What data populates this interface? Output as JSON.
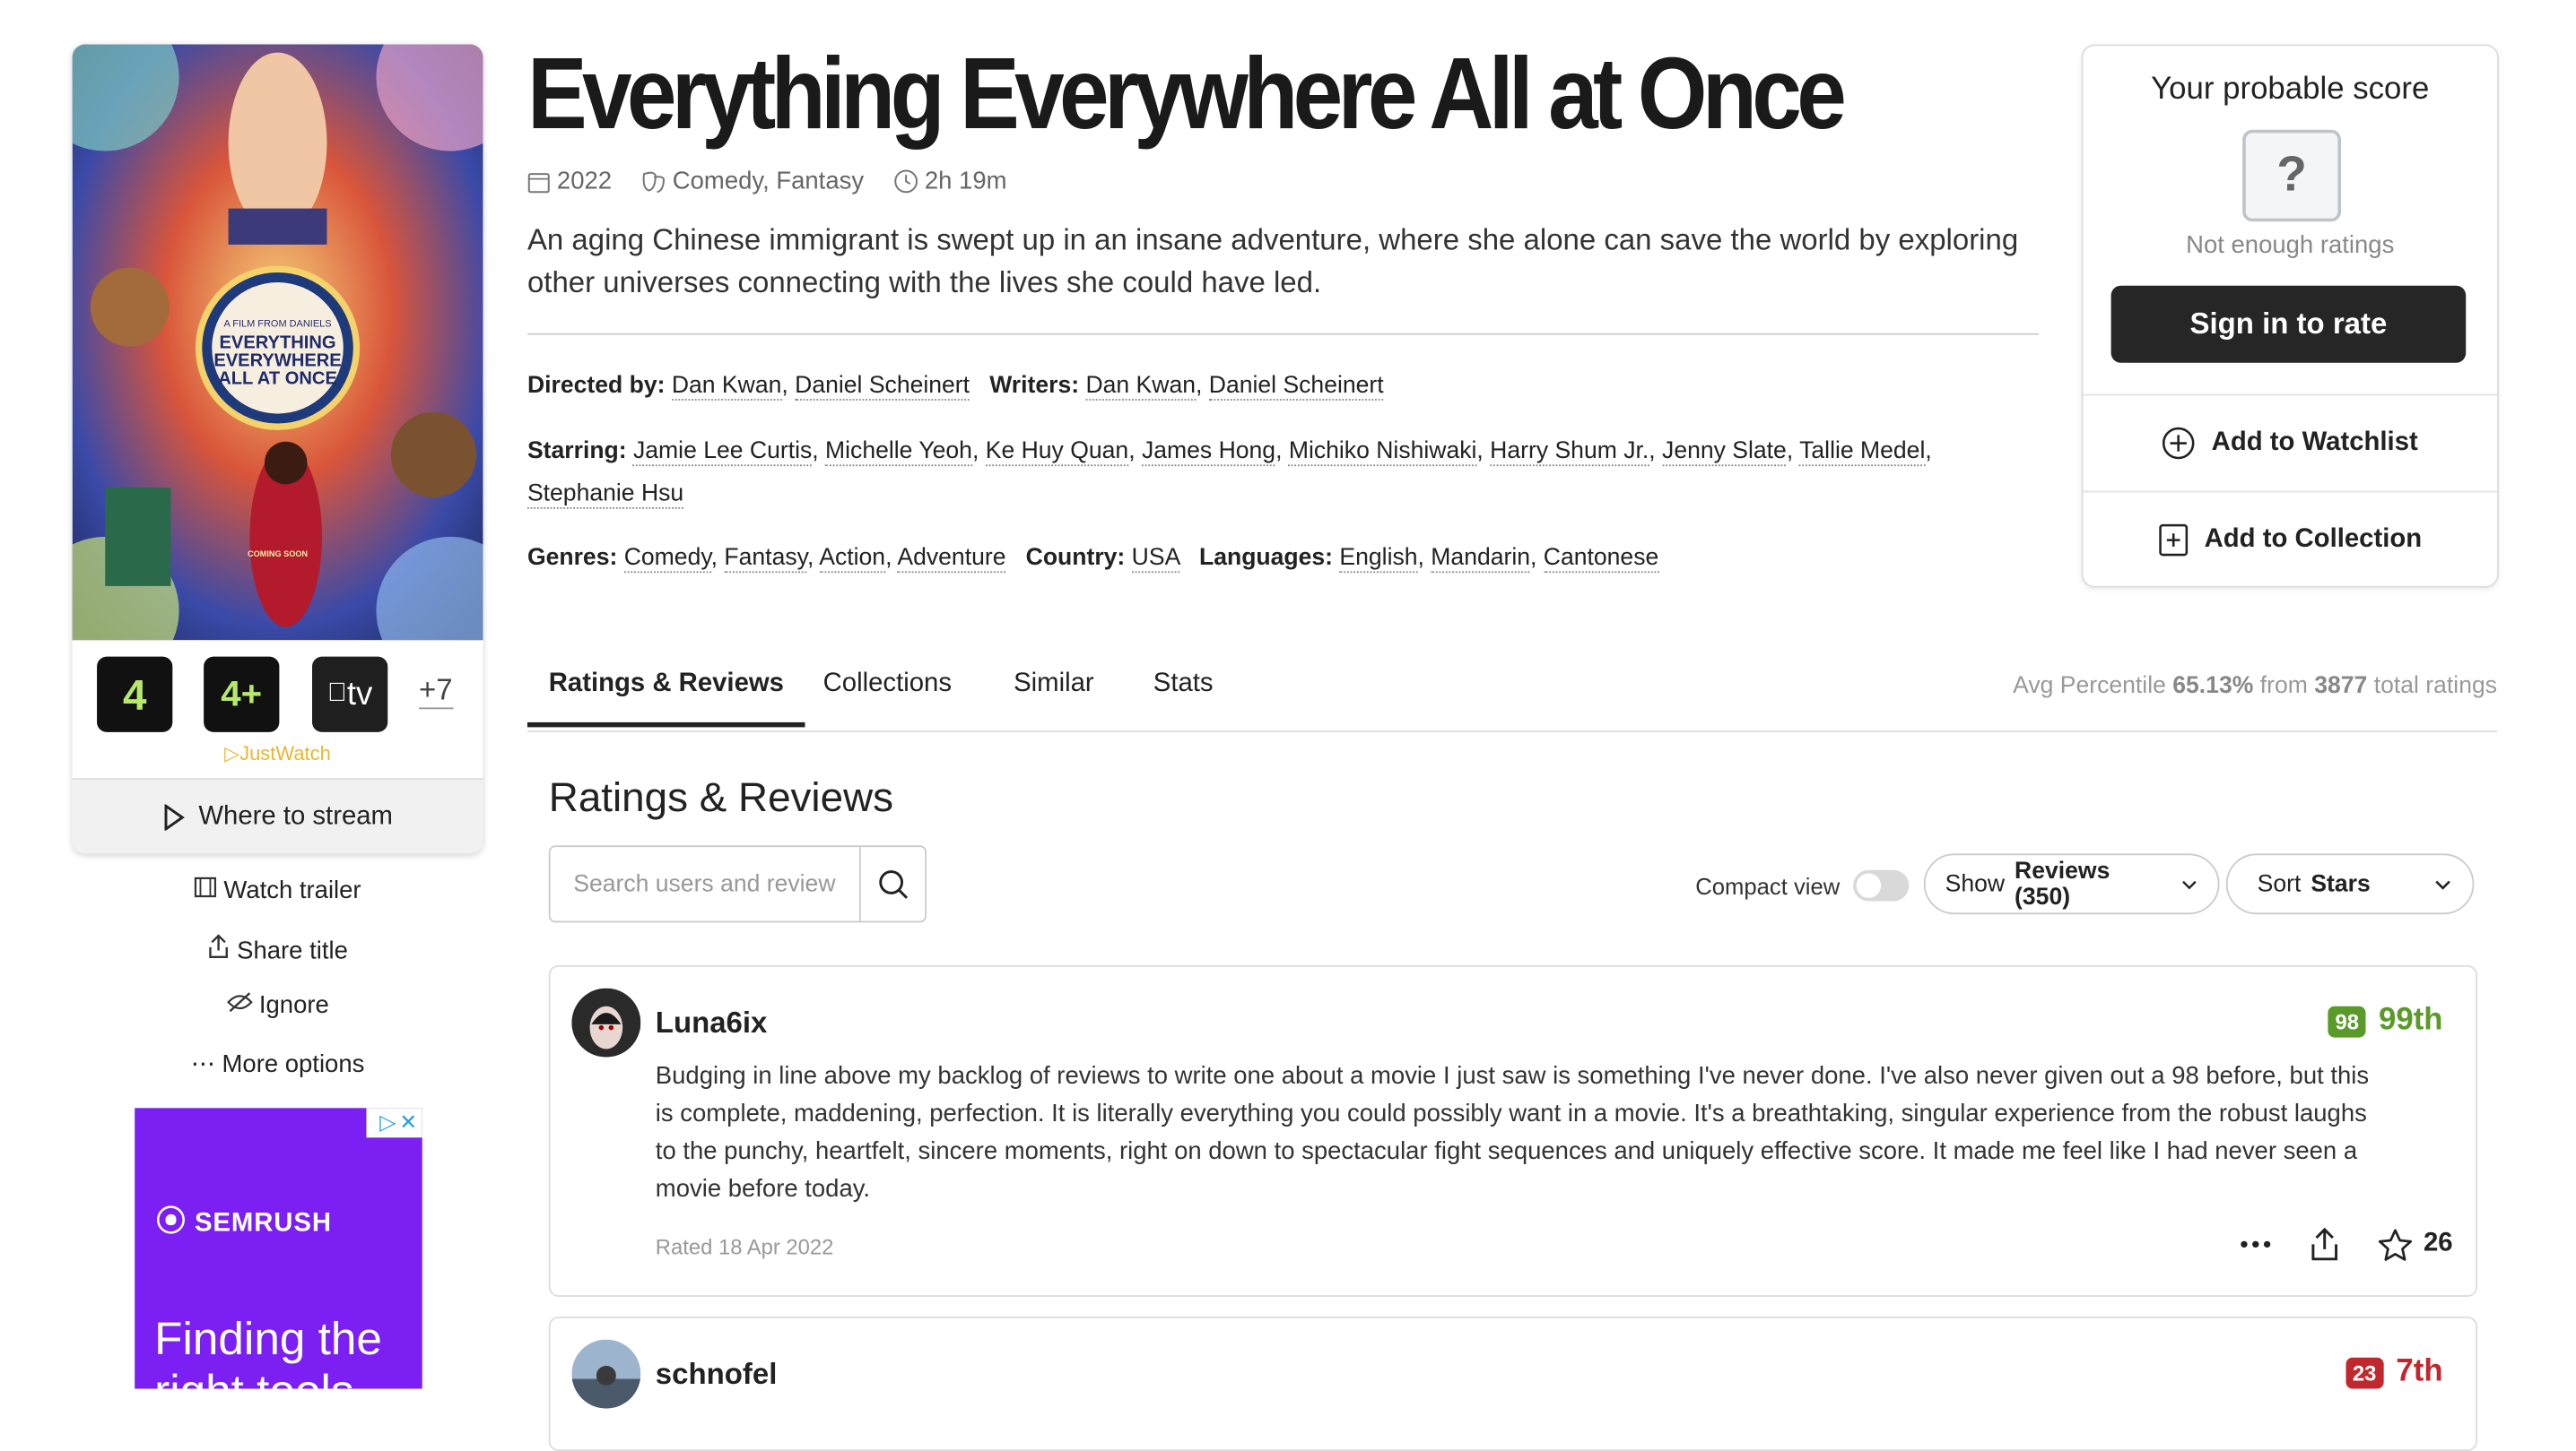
{
  "movie": {
    "title": "Everything Everywhere All at Once",
    "year": "2022",
    "genres_short": "Comedy, Fantasy",
    "runtime": "2h 19m",
    "description": "An aging Chinese immigrant is swept up in an insane adventure, where she alone can save the world by exploring other universes connecting with the lives she could have led.",
    "directed_label": "Directed by:",
    "directors": [
      "Dan Kwan",
      "Daniel Scheinert"
    ],
    "writers_label": "Writers:",
    "writers": [
      "Dan Kwan",
      "Daniel Scheinert"
    ],
    "starring_label": "Starring:",
    "cast": [
      "Jamie Lee Curtis",
      "Michelle Yeoh",
      "Ke Huy Quan",
      "James Hong",
      "Michiko Nishiwaki",
      "Harry Shum Jr.",
      "Jenny Slate",
      "Tallie Medel",
      "Stephanie Hsu"
    ],
    "genres_label": "Genres:",
    "genres": [
      "Comedy",
      "Fantasy",
      "Action",
      "Adventure"
    ],
    "country_label": "Country:",
    "country": "USA",
    "languages_label": "Languages:",
    "languages": [
      "English",
      "Mandarin",
      "Cantonese"
    ]
  },
  "poster": {
    "lines": [
      "A FILM FROM DANIELS",
      "EVERYTHING",
      "EVERYWHERE",
      "ALL AT ONCE",
      "COMING SOON"
    ]
  },
  "providers": {
    "items": [
      {
        "name": "channel4-icon",
        "label": "4"
      },
      {
        "name": "channel4-plus-icon",
        "label": "4+"
      },
      {
        "name": "apple-tv-icon",
        "label": "tv"
      }
    ],
    "more": "+7",
    "justwatch": "JustWatch",
    "stream_label": "Where to stream"
  },
  "side_actions": {
    "trailer": "Watch trailer",
    "share": "Share title",
    "ignore": "Ignore",
    "more": "More options"
  },
  "ad": {
    "brand": "SEMRUSH",
    "headline": "Finding the right tools"
  },
  "score_panel": {
    "title": "Your probable score",
    "placeholder": "?",
    "note": "Not enough ratings",
    "signin": "Sign in to rate",
    "watchlist": "Add to Watchlist",
    "collection": "Add to Collection"
  },
  "tabs": [
    "Ratings & Reviews",
    "Collections",
    "Similar",
    "Stats"
  ],
  "avg": {
    "prefix": "Avg Percentile",
    "value": "65.13%",
    "mid": "from",
    "count": "3877",
    "suffix": "total ratings"
  },
  "reviews_section": {
    "title": "Ratings & Reviews",
    "search_placeholder": "Search users and review",
    "compact_label": "Compact view",
    "show_prefix": "Show",
    "show_value": "Reviews (350)",
    "sort_prefix": "Sort",
    "sort_value": "Stars"
  },
  "reviews": [
    {
      "user": "Luna6ix",
      "score": "98",
      "percentile": "99th",
      "color": "#5a9a2a",
      "text": "Budging in line above my backlog of reviews to write one about a movie I just saw is something I've never done. I've also never given out a 98 before, but this is complete, maddening, perfection. It is literally everything you could possibly want in a movie. It's a breathtaking, singular experience from the robust laughs to the punchy, heartfelt, sincere moments, right on down to spectacular fight sequences and uniquely effective score. It made me feel like I had never seen a movie before today.",
      "date": "Rated 18 Apr 2022",
      "likes": "26"
    },
    {
      "user": "schnofel",
      "score": "23",
      "percentile": "7th",
      "color": "#c0282d"
    }
  ],
  "colors": {
    "green": "#5a9a2a",
    "red": "#c0282d",
    "dark_button": "#262626",
    "ad_purple": "#7b1ff2"
  }
}
